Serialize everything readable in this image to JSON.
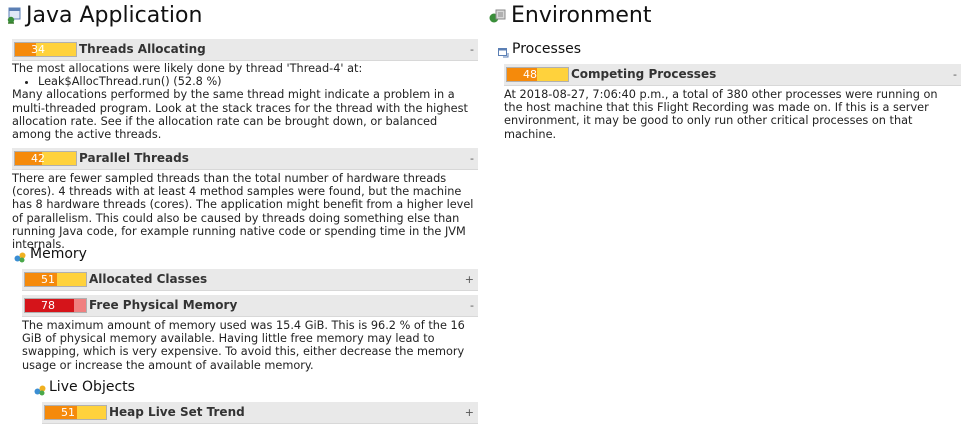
{
  "java_app": {
    "title": "Java Application",
    "results": [
      {
        "score": "34",
        "title": "Threads Allocating",
        "toggle": "-",
        "desc_intro": "The most allocations were likely done by thread 'Thread-4' at:",
        "desc_bullet": "Leak$AllocThread.run() (52.8 %)",
        "desc_body": "Many allocations performed by the same thread might indicate a problem in a multi-threaded program. Look at the stack traces for the thread with the highest allocation rate. See if the allocation rate can be brought down, or balanced among the active threads."
      },
      {
        "score": "42",
        "title": "Parallel Threads",
        "toggle": "-",
        "desc": "There are fewer sampled threads than the total number of hardware threads (cores). 4 threads with at least 4 method samples were found, but the machine has 8 hardware threads (cores). The application might benefit from a higher level of parallelism. This could also be caused by threads doing something else than running Java code, for example running native code or spending time in the JVM internals."
      }
    ]
  },
  "memory": {
    "title": "Memory",
    "results": [
      {
        "score": "51",
        "title": "Allocated Classes",
        "toggle": "+"
      },
      {
        "score": "78",
        "title": "Free Physical Memory",
        "toggle": "-",
        "desc": "The maximum amount of memory used was 15.4 GiB. This is 96.2 % of the 16 GiB of physical memory available. Having little free memory may lead to swapping, which is very expensive. To avoid this, either decrease the memory usage or increase the amount of available memory."
      }
    ]
  },
  "live_objects": {
    "title": "Live Objects",
    "results": [
      {
        "score": "51",
        "title": "Heap Live Set Trend",
        "toggle": "+"
      }
    ]
  },
  "environment": {
    "title": "Environment"
  },
  "processes": {
    "title": "Processes",
    "results": [
      {
        "score": "48",
        "title": "Competing Processes",
        "toggle": "-",
        "desc": "At 2018-08-27, 7:06:40 p.m., a total of 380 other processes were running on the host machine that this Flight Recording was made on. If this is a server environment, it may be good to only run other critical processes on that machine."
      }
    ]
  },
  "colors": {
    "bar_bg": "#e9e9e9",
    "orange": "#f58a0b",
    "yellow": "#ffd23c",
    "red": "#d5141a",
    "pink": "#f08080"
  },
  "icons": [
    "java-app-icon",
    "environment-icon",
    "memory-icon",
    "live-objects-icon",
    "processes-icon"
  ]
}
